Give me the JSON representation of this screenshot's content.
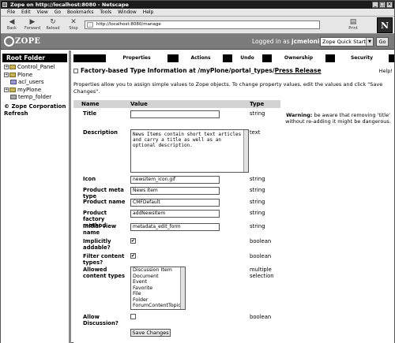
{
  "window": {
    "title": "Zope on http://localhost:8080 - Netscape"
  },
  "menu": [
    "File",
    "Edit",
    "View",
    "Go",
    "Bookmarks",
    "Tools",
    "Window",
    "Help"
  ],
  "toolbar": {
    "back": "Back",
    "forward": "Forward",
    "reload": "Reload",
    "stop": "Stop",
    "print": "Print",
    "url": "http://localhost:8080/manage"
  },
  "zmi": {
    "logo": "ZOPE",
    "logged_prefix": "Logged in as",
    "user": "jcmeloni",
    "quick_start": "Zope Quick Start",
    "go": "Go"
  },
  "tree": {
    "root": "Root Folder",
    "items": [
      "Control_Panel",
      "Plone",
      "acl_users",
      "myPlone",
      "temp_folder"
    ],
    "corp": "Zope Corporation",
    "refresh": "Refresh"
  },
  "tabs": [
    "Properties",
    "Actions",
    "Undo",
    "Ownership",
    "Security"
  ],
  "page": {
    "heading_prefix": "Factory-based Type Information at",
    "heading_path": "/myPlone/portal_types/",
    "heading_link": "Press Release",
    "help": "Help!",
    "info": "Properties allow you to assign simple values to Zope objects. To change property values, edit the values and click \"Save Changes\"."
  },
  "table": {
    "col_name": "Name",
    "col_value": "Value",
    "col_type": "Type"
  },
  "warning": {
    "strong": "Warning:",
    "text": "be aware that removing 'title' without re-adding it might be dangerous."
  },
  "props": {
    "title": {
      "label": "Title",
      "value": "",
      "type": "string"
    },
    "description": {
      "label": "Description",
      "value": "News Items contain short text articles and carry a title as well as an optional description.",
      "type": "text"
    },
    "icon": {
      "label": "Icon",
      "value": "newsitem_icon.gif",
      "type": "string"
    },
    "meta": {
      "label": "Product meta type",
      "value": "News Item",
      "type": "string"
    },
    "pname": {
      "label": "Product name",
      "value": "CMFDefault",
      "type": "string"
    },
    "factory": {
      "label": "Product factory method",
      "value": "addNewsItem",
      "type": "string"
    },
    "iview": {
      "label": "Initial view name",
      "value": "metadata_edit_form",
      "type": "string"
    },
    "implicit": {
      "label": "Implicitly addable?",
      "mark": "✔",
      "type": "boolean"
    },
    "filter": {
      "label": "Filter content types?",
      "mark": "✔",
      "type": "boolean"
    },
    "allowed": {
      "label": "Allowed content types",
      "options": [
        "Discussion Item",
        "Document",
        "Event",
        "Favorite",
        "File",
        "Folder",
        "ForumContentTopic"
      ],
      "type": "multiple selection"
    },
    "discussion": {
      "label": "Allow Discussion?",
      "type": "boolean"
    }
  },
  "save_label": "Save Changes"
}
